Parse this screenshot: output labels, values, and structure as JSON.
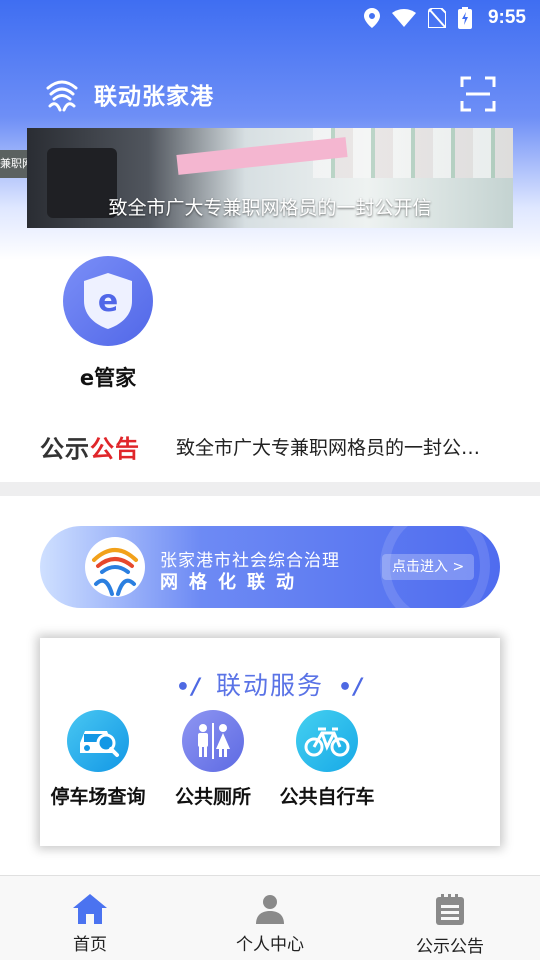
{
  "status_bar": {
    "time": "9:55"
  },
  "header": {
    "title": "联动张家港"
  },
  "banner": {
    "caption": "致全市广大专兼职网格员的一封公开信",
    "prev_snippet": "兼职网"
  },
  "e_steward": {
    "label": "e管家",
    "icon_letter": "e"
  },
  "notice": {
    "badge_part1": "公示",
    "badge_part2": "公告",
    "text": "致全市广大专兼职网格员的一封公开信"
  },
  "grid_banner": {
    "line1": "张家港市社会综合治理",
    "line2": "网格化联动",
    "enter_label": "点击进入 >"
  },
  "services": {
    "title": "联动服务",
    "items": [
      {
        "label": "停车场查询",
        "icon": "car-search-icon"
      },
      {
        "label": "公共厕所",
        "icon": "restroom-icon"
      },
      {
        "label": "公共自行车",
        "icon": "bicycle-icon"
      }
    ]
  },
  "bottom_nav": {
    "items": [
      {
        "label": "首页",
        "icon": "home-icon"
      },
      {
        "label": "个人中心",
        "icon": "user-icon"
      },
      {
        "label": "公示公告",
        "icon": "notice-board-icon"
      }
    ]
  },
  "colors": {
    "primary": "#3f6ef2",
    "accent_red": "#e0262a",
    "service_title": "#5a73e6"
  }
}
